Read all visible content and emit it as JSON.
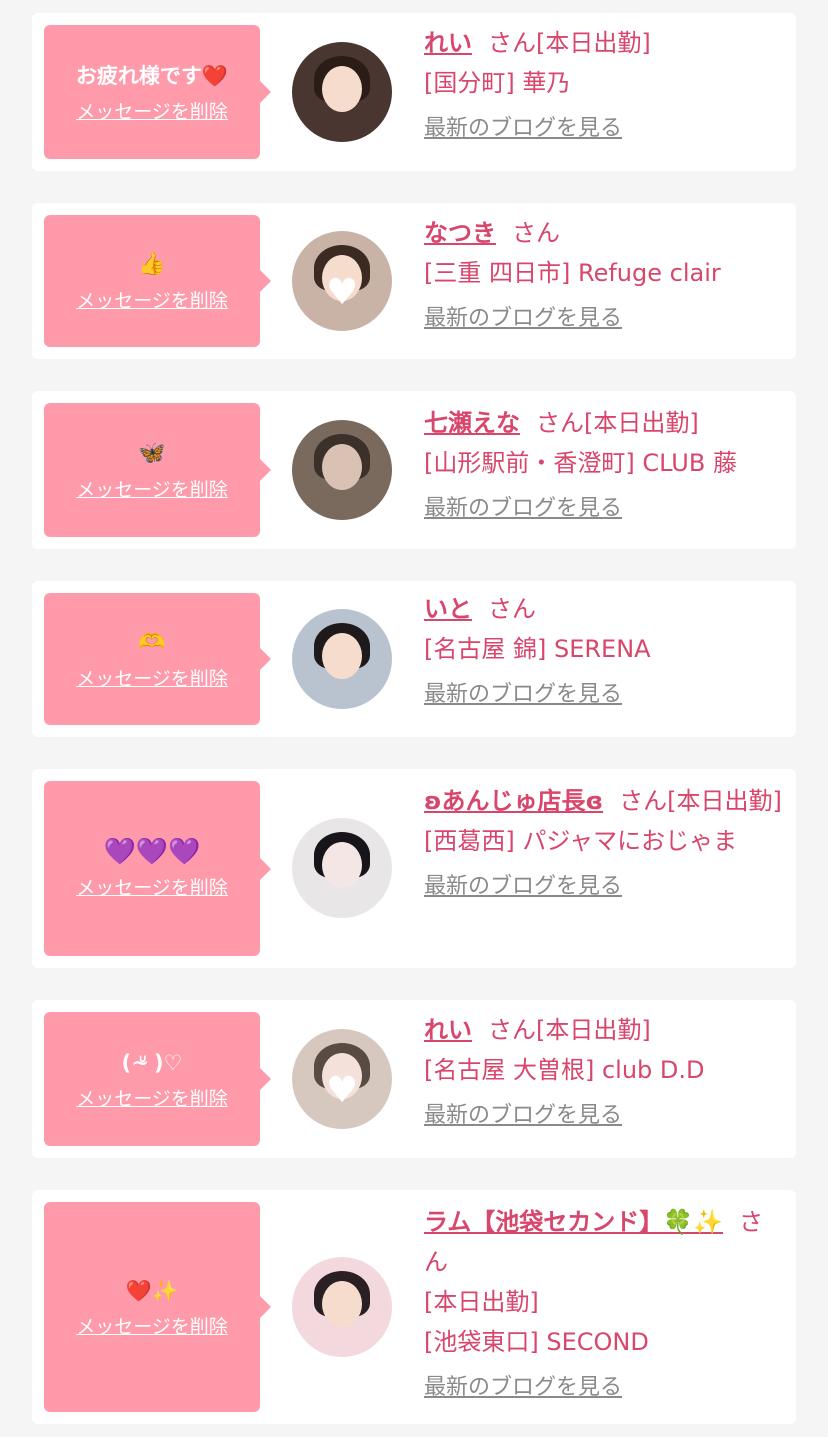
{
  "cards": [
    {
      "message": "お疲れ様です❤️",
      "delete_label": "メッセージを削除",
      "name": "れい",
      "honorific": "さん",
      "status": "[本日出勤]",
      "shop": "[国分町] 華乃",
      "blog_label": "最新のブログを見る"
    },
    {
      "message": "👍",
      "delete_label": "メッセージを削除",
      "name": "なつき",
      "honorific": "さん",
      "status": "",
      "shop": "[三重 四日市] Refuge clair",
      "blog_label": "最新のブログを見る"
    },
    {
      "message": "🦋",
      "delete_label": "メッセージを削除",
      "name": "七瀬えな",
      "honorific": "さん",
      "status": "[本日出勤]",
      "shop": "[山形駅前・香澄町] CLUB 藤",
      "blog_label": "最新のブログを見る"
    },
    {
      "message": "🫶",
      "delete_label": "メッセージを削除",
      "name": "いと",
      "honorific": "さん",
      "status": "",
      "shop": "[名古屋 錦] SERENA",
      "blog_label": "最新のブログを見る"
    },
    {
      "message": "💜💜💜",
      "delete_label": "メッセージを削除",
      "name": "ʚあんじゅ店長ɞ",
      "honorific": "さん",
      "status": "[本日出勤]",
      "shop": "[西葛西] パジャマにおじゃま",
      "blog_label": "最新のブログを見る"
    },
    {
      "message": "( ᐡ̴ )♡",
      "delete_label": "メッセージを削除",
      "name": "れい",
      "honorific": "さん",
      "status": "[本日出勤]",
      "shop": "[名古屋 大曽根] club D.D",
      "blog_label": "最新のブログを見る"
    },
    {
      "message": "❤️✨",
      "delete_label": "メッセージを削除",
      "name": "ラム【池袋セカンド】🍀✨",
      "honorific": "さん",
      "status": "[本日出勤]",
      "shop": "[池袋東口] SECOND",
      "blog_label": "最新のブログを見る"
    }
  ],
  "colors": {
    "accent": "#d8466c",
    "bubble": "#ff9aab",
    "link_gray": "#8a8a8a",
    "background": "#f6f5f6"
  }
}
